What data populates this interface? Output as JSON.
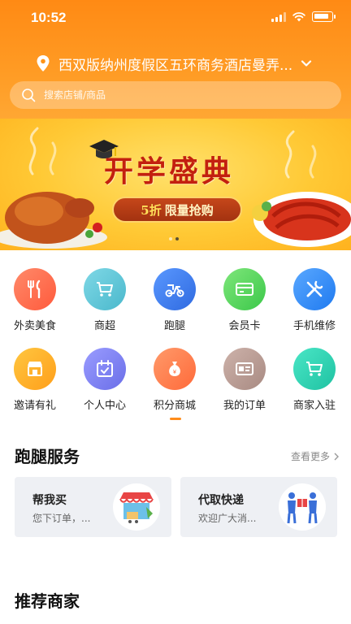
{
  "status_bar": {
    "time": "10:52"
  },
  "header": {
    "location": "西双版纳州度假区五环商务酒店曼弄...",
    "search_placeholder": "搜索店铺/商品",
    "brand_color": "#ff9418"
  },
  "banner": {
    "title": "开学盛典",
    "tag_highlight": "5折",
    "tag_text": "限量抢购",
    "slides": 2,
    "active_slide": 2
  },
  "services": [
    {
      "label": "外卖美食",
      "icon": "cutlery-icon",
      "color": "#ff6b52"
    },
    {
      "label": "商超",
      "icon": "cart-icon",
      "color": "#5ac8d8"
    },
    {
      "label": "跑腿",
      "icon": "scooter-icon",
      "color": "#3f7ef0"
    },
    {
      "label": "会员卡",
      "icon": "card-icon",
      "color": "#4cd964"
    },
    {
      "label": "手机维修",
      "icon": "tools-icon",
      "color": "#2f8bf5"
    },
    {
      "label": "邀请有礼",
      "icon": "shop-icon",
      "color": "#ffb020"
    },
    {
      "label": "个人中心",
      "icon": "calendar-icon",
      "color": "#7a7ff0"
    },
    {
      "label": "积分商城",
      "icon": "points-bag-icon",
      "color": "#ff7a4c"
    },
    {
      "label": "我的订单",
      "icon": "id-card-icon",
      "color": "#b89a92"
    },
    {
      "label": "商家入驻",
      "icon": "cart-icon",
      "color": "#2fd0b0"
    }
  ],
  "errand_section": {
    "title": "跑腿服务",
    "more": "查看更多",
    "cards": [
      {
        "title": "帮我买",
        "subtitle": "您下订单，...",
        "icon": "storefront-icon"
      },
      {
        "title": "代取快递",
        "subtitle": "欢迎广大消...",
        "icon": "courier-icon"
      }
    ]
  },
  "recommend_section": {
    "title": "推荐商家"
  }
}
